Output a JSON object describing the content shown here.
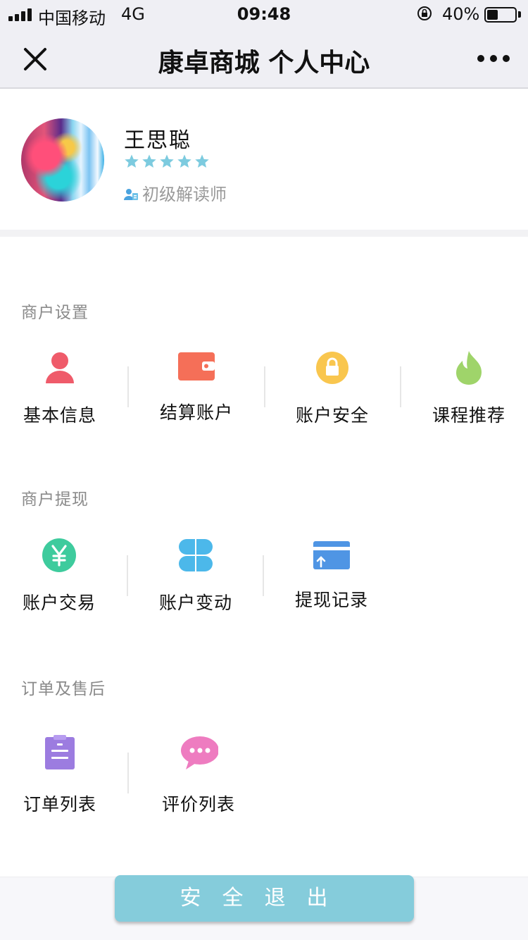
{
  "status_bar": {
    "carrier": "中国移动",
    "network": "4G",
    "time": "09:48",
    "battery": "40%",
    "battery_level": 0.4
  },
  "nav": {
    "title": "康卓商城 个人中心",
    "close_icon": "close-icon",
    "more_icon": "more-icon"
  },
  "profile": {
    "name": "王思聪",
    "rating_stars": 5,
    "role": "初级解读师",
    "star_color": "#7dcbdf"
  },
  "sections": [
    {
      "title": "商户设置",
      "items": [
        {
          "label": "基本信息",
          "icon": "user-icon",
          "color": "#ef5b6a"
        },
        {
          "label": "结算账户",
          "icon": "wallet-icon",
          "color": "#f56f58"
        },
        {
          "label": "账户安全",
          "icon": "lock-icon",
          "color": "#f9c64e"
        },
        {
          "label": "课程推荐",
          "icon": "flame-icon",
          "color": "#9fd46a"
        }
      ]
    },
    {
      "title": "商户提现",
      "items": [
        {
          "label": "账户交易",
          "icon": "yen-icon",
          "color": "#3ecb9d"
        },
        {
          "label": "账户变动",
          "icon": "clover-icon",
          "color": "#4cb8ea"
        },
        {
          "label": "提现记录",
          "icon": "card-upload-icon",
          "color": "#4f95e4"
        }
      ]
    },
    {
      "title": "订单及售后",
      "items": [
        {
          "label": "订单列表",
          "icon": "clipboard-icon",
          "color": "#9c7ce0"
        },
        {
          "label": "评价列表",
          "icon": "comment-icon",
          "color": "#ee7cc0"
        }
      ]
    }
  ],
  "logout_label": "安全退出",
  "colors": {
    "logout_button": "#85ccdb",
    "background": "#efeff4"
  }
}
